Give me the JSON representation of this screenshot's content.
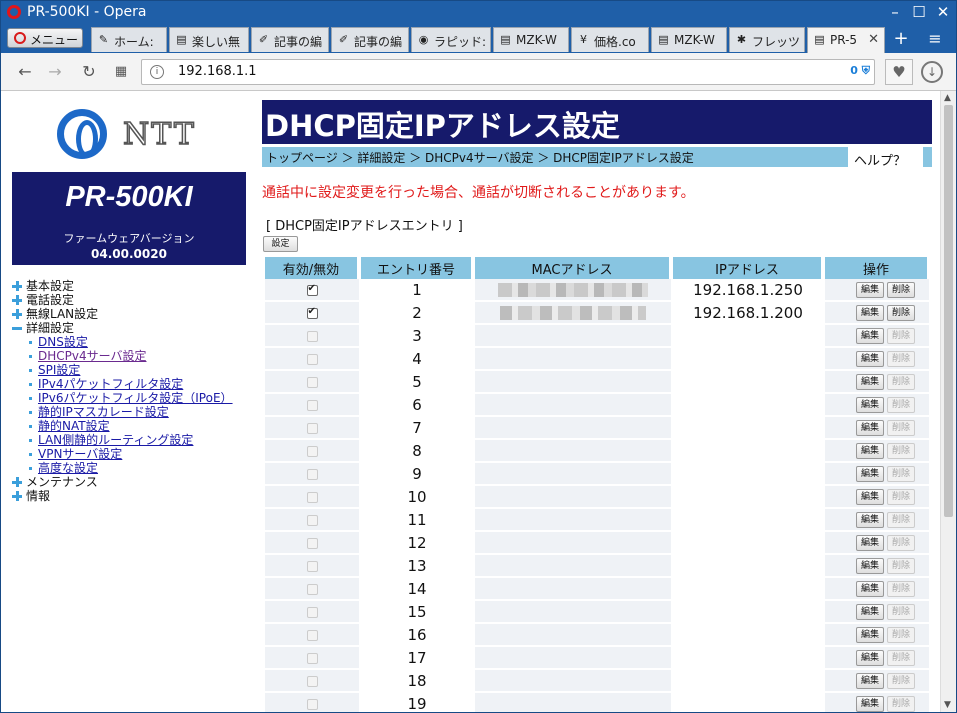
{
  "window": {
    "title": "PR-500KI - Opera"
  },
  "browser": {
    "menu_label": "メニュー",
    "tabs": [
      {
        "label": "ホーム:",
        "icon": "pencil-icon"
      },
      {
        "label": "楽しい無",
        "icon": "page-icon"
      },
      {
        "label": "記事の編",
        "icon": "edit-icon"
      },
      {
        "label": "記事の編",
        "icon": "edit-icon"
      },
      {
        "label": "ラピッド:",
        "icon": "app-icon"
      },
      {
        "label": "MZK-W",
        "icon": "page-icon"
      },
      {
        "label": "価格.co",
        "icon": "kakaku-icon"
      },
      {
        "label": "MZK-W",
        "icon": "page-icon"
      },
      {
        "label": "フレッツ",
        "icon": "flets-icon"
      },
      {
        "label": "PR-5",
        "icon": "page-icon",
        "active": true
      }
    ],
    "url": "192.168.1.1",
    "adblock_count": "0"
  },
  "sidebar": {
    "logo_text": "NTT",
    "model": "PR-500KI",
    "firmware_label": "ファームウェアバージョン",
    "firmware_version": "04.00.0020",
    "nav": [
      {
        "label": "基本設定",
        "type": "top",
        "expanded": false
      },
      {
        "label": "電話設定",
        "type": "top",
        "expanded": false
      },
      {
        "label": "無線LAN設定",
        "type": "top",
        "expanded": false
      },
      {
        "label": "詳細設定",
        "type": "top",
        "expanded": true
      },
      {
        "label": "DNS設定",
        "type": "sub"
      },
      {
        "label": "DHCPv4サーバ設定",
        "type": "sub",
        "visited": true
      },
      {
        "label": "SPI設定",
        "type": "sub"
      },
      {
        "label": "IPv4パケットフィルタ設定",
        "type": "sub"
      },
      {
        "label": "IPv6パケットフィルタ設定（IPoE）",
        "type": "sub"
      },
      {
        "label": "静的IPマスカレード設定",
        "type": "sub"
      },
      {
        "label": "静的NAT設定",
        "type": "sub"
      },
      {
        "label": "LAN側静的ルーティング設定",
        "type": "sub"
      },
      {
        "label": "VPNサーバ設定",
        "type": "sub"
      },
      {
        "label": "高度な設定",
        "type": "sub"
      },
      {
        "label": "メンテナンス",
        "type": "top",
        "expanded": false
      },
      {
        "label": "情報",
        "type": "top",
        "expanded": false
      }
    ]
  },
  "main": {
    "title": "DHCP固定IPアドレス設定",
    "breadcrumb": "トップページ ＞ 詳細設定 ＞ DHCPv4サーバ設定 ＞ DHCP固定IPアドレス設定",
    "help": "ヘルプ？",
    "warning": "通話中に設定変更を行った場合、通話が切断されることがあります。",
    "entry_label": "[ DHCP固定IPアドレスエントリ ]",
    "set_button": "設定",
    "table": {
      "headers": [
        "有効/無効",
        "エントリ番号",
        "MACアドレス",
        "IPアドレス",
        "操作"
      ],
      "edit_label": "編集",
      "delete_label": "削除",
      "rows": [
        {
          "checked": true,
          "num": "1",
          "mac_masked": true,
          "ip": "192.168.1.250"
        },
        {
          "checked": true,
          "num": "2",
          "mac_masked": true,
          "ip": "192.168.1.200"
        },
        {
          "checked": false,
          "num": "3",
          "mac_masked": false,
          "ip": ""
        },
        {
          "checked": false,
          "num": "4",
          "mac_masked": false,
          "ip": ""
        },
        {
          "checked": false,
          "num": "5",
          "mac_masked": false,
          "ip": ""
        },
        {
          "checked": false,
          "num": "6",
          "mac_masked": false,
          "ip": ""
        },
        {
          "checked": false,
          "num": "7",
          "mac_masked": false,
          "ip": ""
        },
        {
          "checked": false,
          "num": "8",
          "mac_masked": false,
          "ip": ""
        },
        {
          "checked": false,
          "num": "9",
          "mac_masked": false,
          "ip": ""
        },
        {
          "checked": false,
          "num": "10",
          "mac_masked": false,
          "ip": ""
        },
        {
          "checked": false,
          "num": "11",
          "mac_masked": false,
          "ip": ""
        },
        {
          "checked": false,
          "num": "12",
          "mac_masked": false,
          "ip": ""
        },
        {
          "checked": false,
          "num": "13",
          "mac_masked": false,
          "ip": ""
        },
        {
          "checked": false,
          "num": "14",
          "mac_masked": false,
          "ip": ""
        },
        {
          "checked": false,
          "num": "15",
          "mac_masked": false,
          "ip": ""
        },
        {
          "checked": false,
          "num": "16",
          "mac_masked": false,
          "ip": ""
        },
        {
          "checked": false,
          "num": "17",
          "mac_masked": false,
          "ip": ""
        },
        {
          "checked": false,
          "num": "18",
          "mac_masked": false,
          "ip": ""
        },
        {
          "checked": false,
          "num": "19",
          "mac_masked": false,
          "ip": ""
        }
      ]
    }
  },
  "colors": {
    "header_navy": "#161a6b",
    "light_blue": "#88c5e1",
    "warning_red": "#e11b1b",
    "link_blue": "#1a1aa6",
    "opera_frame": "#1f5fa8"
  }
}
